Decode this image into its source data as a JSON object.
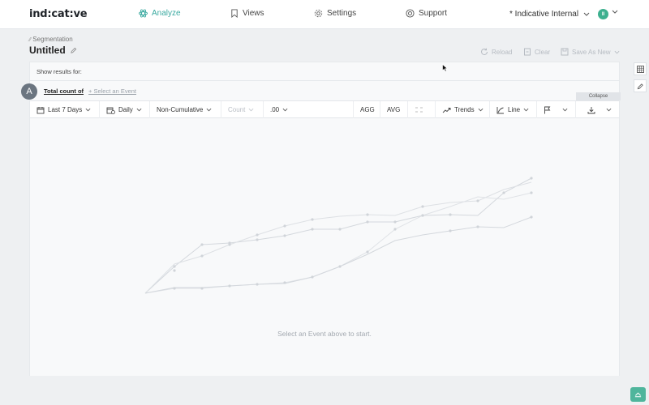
{
  "nav": {
    "logo": "ind:cat:ve",
    "items": [
      {
        "label": "Analyze",
        "icon": "atom-icon"
      },
      {
        "label": "Views",
        "icon": "bookmark-icon"
      },
      {
        "label": "Settings",
        "icon": "gear-icon"
      },
      {
        "label": "Support",
        "icon": "lifebuoy-icon"
      }
    ],
    "org": "* Indicative Internal",
    "avatar_initials": "II"
  },
  "header": {
    "breadcrumb": "Segmentation",
    "title": "Untitled",
    "actions": {
      "reload": "Reload",
      "clear": "Clear",
      "save_as_new": "Save As New"
    }
  },
  "query": {
    "show_results_for": "Show results for:",
    "row_letter": "A",
    "metric": "Total count of",
    "select_event": "+ Select an Event",
    "collapse": "Collapse"
  },
  "toolbar": {
    "date_range": "Last 7 Days",
    "interval": "Daily",
    "cumulative": "Non-Cumulative",
    "count": "Count",
    "decimals": ".00",
    "agg": "AGG",
    "avg": "AVG",
    "trends": "Trends",
    "chart_type": "Line"
  },
  "chart": {
    "empty_message": "Select an Event above to start."
  }
}
